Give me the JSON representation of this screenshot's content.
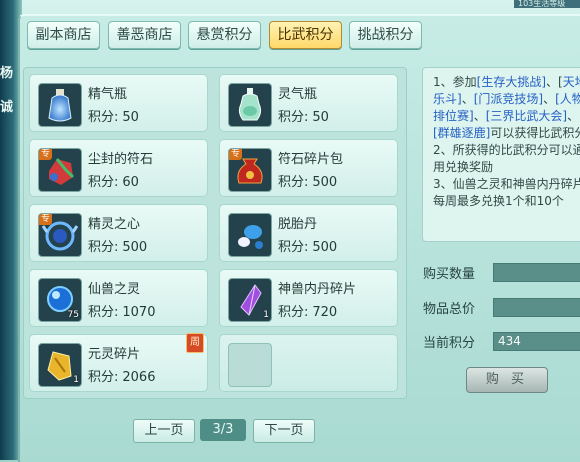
{
  "header": {
    "level_text": "103生活等级"
  },
  "left_deco": [
    "杨",
    "诚"
  ],
  "tabs": [
    {
      "label": "副本商店",
      "active": false
    },
    {
      "label": "善恶商店",
      "active": false
    },
    {
      "label": "悬赏积分",
      "active": false
    },
    {
      "label": "比武积分",
      "active": true
    },
    {
      "label": "挑战积分",
      "active": false
    }
  ],
  "price_label": "积分:",
  "items": [
    {
      "name": "精气瓶",
      "price": "50",
      "icon": "spirit-bottle-icon"
    },
    {
      "name": "灵气瓶",
      "price": "50",
      "icon": "aura-bottle-icon"
    },
    {
      "name": "尘封的符石",
      "price": "60",
      "icon": "sealed-rune-stone-icon",
      "badge": "专"
    },
    {
      "name": "符石碎片包",
      "price": "500",
      "icon": "rune-fragment-bag-icon",
      "badge": "专"
    },
    {
      "name": "精灵之心",
      "price": "500",
      "icon": "elf-heart-icon",
      "badge": "专"
    },
    {
      "name": "脱胎丹",
      "price": "500",
      "icon": "rebirth-pill-icon"
    },
    {
      "name": "仙兽之灵",
      "price": "1070",
      "icon": "divine-beast-spirit-icon",
      "count": "75"
    },
    {
      "name": "神兽内丹碎片",
      "price": "720",
      "icon": "beast-core-fragment-icon",
      "count": "1"
    },
    {
      "name": "元灵碎片",
      "price": "2066",
      "icon": "yuanling-fragment-icon",
      "count": "1",
      "week_badge": "周"
    }
  ],
  "description": {
    "p1_start": "1、参加",
    "t1": "[生存大挑战]",
    "p1_b": "、[",
    "t2": "天地乐斗]",
    "p1_c": "、",
    "t3": "[门派竞技场]",
    "p1_d": "、",
    "t4": "[人物排位赛]",
    "p1_e": "、",
    "t5": "[三界比武大会]",
    "p1_f": "、",
    "t6": "[群雄逐鹿]",
    "p1_g": "可以获得比武积分",
    "p2": "2、所获得的比武积分可以通用兑换奖励",
    "p3": "3、仙兽之灵和神兽内丹碎片每周最多兑换1个和10个"
  },
  "form": {
    "qty_label": "购买数量",
    "qty_value": "",
    "total_label": "物品总价",
    "total_value": "",
    "points_label": "当前积分",
    "points_value": "434"
  },
  "buy_label": "购 买",
  "pager": {
    "prev": "上一页",
    "indicator": "3/3",
    "next": "下一页"
  }
}
